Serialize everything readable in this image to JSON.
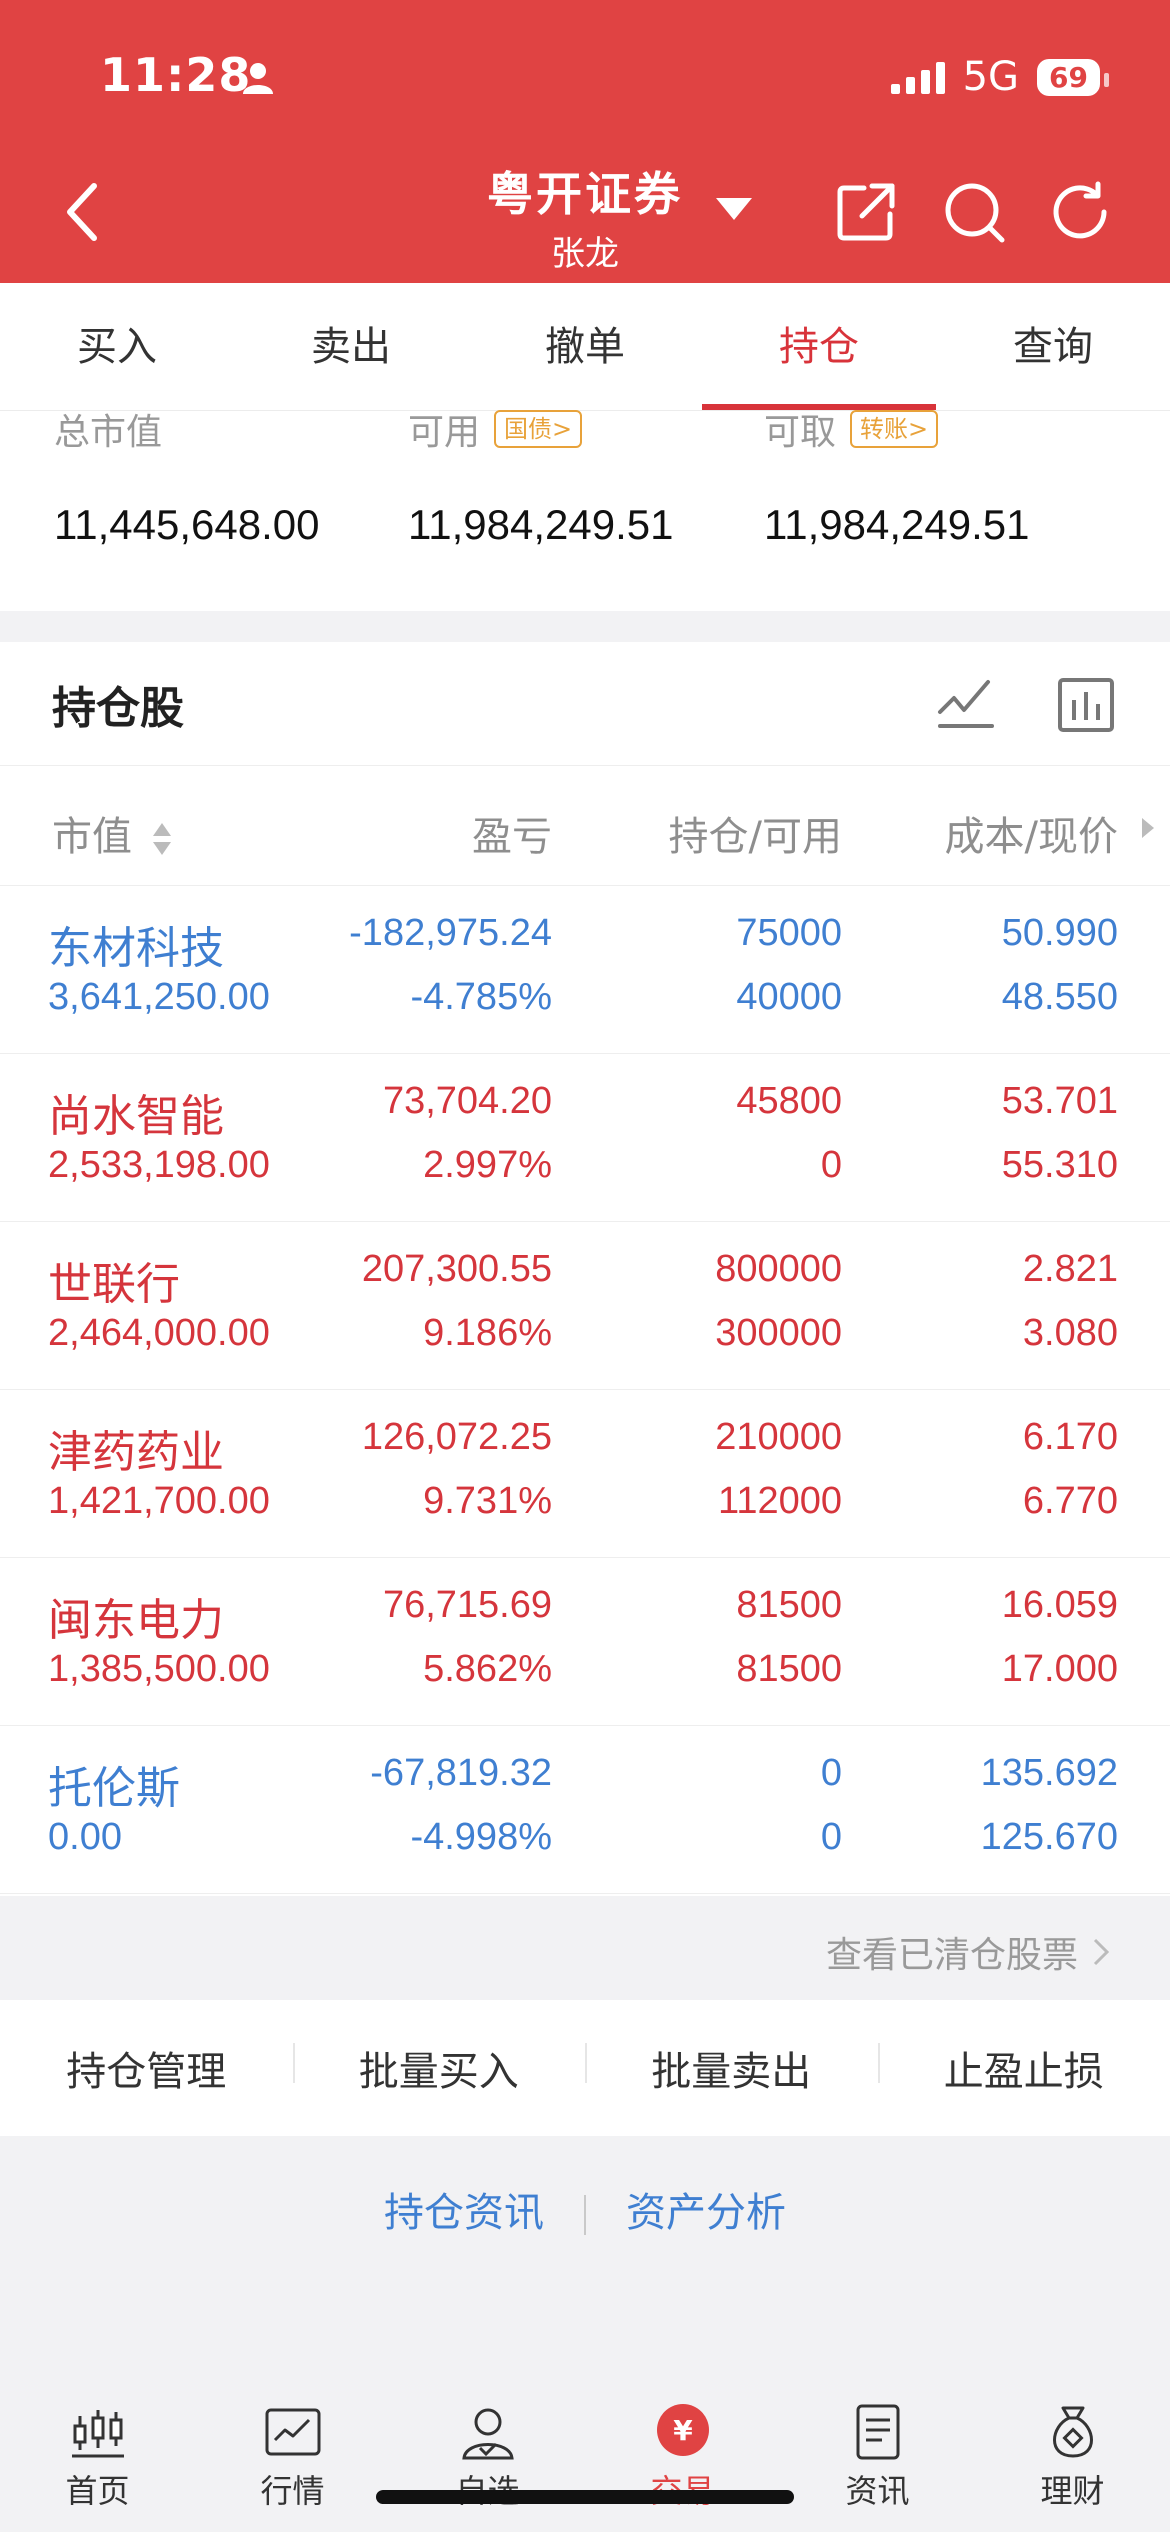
{
  "status_bar": {
    "time": "11:28",
    "network": "5G",
    "battery": "69"
  },
  "header": {
    "title": "粤开证券",
    "subtitle": "张龙"
  },
  "tabs": [
    {
      "label": "买入",
      "active": false
    },
    {
      "label": "卖出",
      "active": false
    },
    {
      "label": "撤单",
      "active": false
    },
    {
      "label": "持仓",
      "active": true
    },
    {
      "label": "查询",
      "active": false
    }
  ],
  "summary": {
    "total_market_value": {
      "label": "总市值",
      "value": "11,445,648.00"
    },
    "available": {
      "label": "可用",
      "tag": "国债>",
      "value": "11,984,249.51"
    },
    "withdrawable": {
      "label": "可取",
      "tag": "转账>",
      "value": "11,984,249.51"
    }
  },
  "holdings": {
    "title": "持仓股",
    "columns": [
      "市值",
      "盈亏",
      "持仓/可用",
      "成本/现价"
    ],
    "rows": [
      {
        "name": "东材科技",
        "market_value": "3,641,250.00",
        "pl": "-182,975.24",
        "pl_pct": "-4.785%",
        "position": "75000",
        "available": "40000",
        "cost": "50.990",
        "price": "48.550",
        "color": "blue"
      },
      {
        "name": "尚水智能",
        "market_value": "2,533,198.00",
        "pl": "73,704.20",
        "pl_pct": "2.997%",
        "position": "45800",
        "available": "0",
        "cost": "53.701",
        "price": "55.310",
        "color": "red"
      },
      {
        "name": "世联行",
        "market_value": "2,464,000.00",
        "pl": "207,300.55",
        "pl_pct": "9.186%",
        "position": "800000",
        "available": "300000",
        "cost": "2.821",
        "price": "3.080",
        "color": "red"
      },
      {
        "name": "津药药业",
        "market_value": "1,421,700.00",
        "pl": "126,072.25",
        "pl_pct": "9.731%",
        "position": "210000",
        "available": "112000",
        "cost": "6.170",
        "price": "6.770",
        "color": "red"
      },
      {
        "name": "闽东电力",
        "market_value": "1,385,500.00",
        "pl": "76,715.69",
        "pl_pct": "5.862%",
        "position": "81500",
        "available": "81500",
        "cost": "16.059",
        "price": "17.000",
        "color": "red"
      },
      {
        "name": "托伦斯",
        "market_value": "0.00",
        "pl": "-67,819.32",
        "pl_pct": "-4.998%",
        "position": "0",
        "available": "0",
        "cost": "135.692",
        "price": "125.670",
        "color": "blue"
      }
    ],
    "cleared_link": "查看已清仓股票"
  },
  "actions": [
    "持仓管理",
    "批量买入",
    "批量卖出",
    "止盈止损"
  ],
  "links": [
    "持仓资讯",
    "资产分析"
  ],
  "bottom_nav": [
    {
      "label": "首页",
      "icon": "candlestick-icon"
    },
    {
      "label": "行情",
      "icon": "chart-icon"
    },
    {
      "label": "自选",
      "icon": "user-icon"
    },
    {
      "label": "交易",
      "icon": "yuan-icon",
      "active": true
    },
    {
      "label": "资讯",
      "icon": "news-icon"
    },
    {
      "label": "理财",
      "icon": "moneybag-icon"
    }
  ],
  "colors": {
    "brand_red": "#e04343",
    "up_red": "#d5353c",
    "down_blue": "#3f7fd1",
    "tag_orange": "#e8a23a"
  }
}
